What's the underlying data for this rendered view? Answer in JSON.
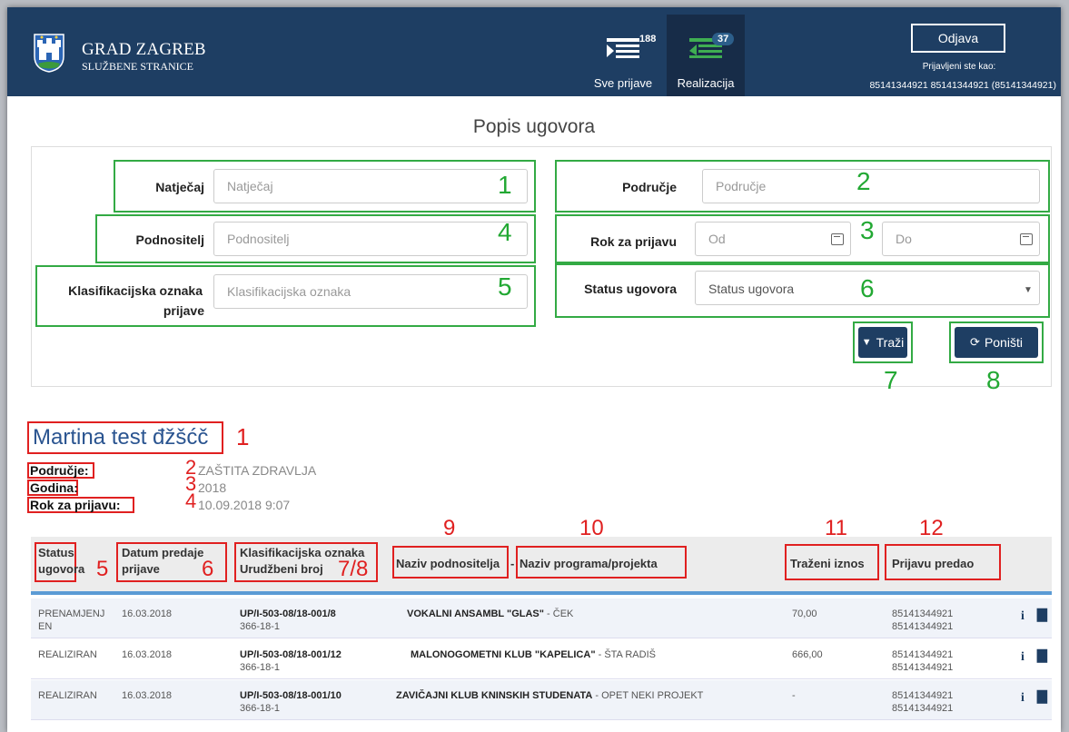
{
  "header": {
    "brand_title": "GRAD ZAGREB",
    "brand_subtitle": "SLUŽBENE STRANICE",
    "nav": [
      {
        "label": "Sve prijave",
        "badge": "188"
      },
      {
        "label": "Realizacija",
        "badge": "37"
      }
    ],
    "logout_label": "Odjava",
    "logged_in_label": "Prijavljeni ste kao:",
    "logged_in_user": "85141344921 85141344921 (85141344921)"
  },
  "page_title": "Popis ugovora",
  "filters": {
    "natjecaj": {
      "label": "Natječaj",
      "placeholder": "Natječaj",
      "num": "1"
    },
    "podrucje": {
      "label": "Područje",
      "placeholder": "Područje",
      "num": "2"
    },
    "rok": {
      "label": "Rok za prijavu",
      "from_placeholder": "Od",
      "to_placeholder": "Do",
      "num": "3"
    },
    "podnositelj": {
      "label": "Podnositelj",
      "placeholder": "Podnositelj",
      "num": "4"
    },
    "klasifikacija": {
      "label_line1": "Klasifikacijska oznaka",
      "label_line2": "prijave",
      "placeholder": "Klasifikacijska oznaka",
      "num": "5"
    },
    "status": {
      "label": "Status ugovora",
      "selected": "Status ugovora",
      "num": "6"
    },
    "search_button": "Traži",
    "reset_button": "Poništi",
    "search_num": "7",
    "reset_num": "8"
  },
  "contest": {
    "name": "Martina test đžšćč",
    "name_num": "1",
    "rows": [
      {
        "label": "Područje:",
        "value": "ZAŠTITA ZDRAVLJA",
        "num": "2"
      },
      {
        "label": "Godina:",
        "value": "2018",
        "num": "3"
      },
      {
        "label": "Rok za prijavu:",
        "value": "10.09.2018 9:07",
        "num": "4"
      }
    ]
  },
  "table": {
    "headers": {
      "status_l1": "Status",
      "status_l2": "ugovora",
      "status_num": "5",
      "datum_l1": "Datum predaje",
      "datum_l2": "prijave",
      "datum_num": "6",
      "klas_l1": "Klasifikacijska oznaka",
      "klas_l2": "Urudžbeni broj",
      "klas_num": "7/8",
      "naziv_podnositelja": "Naziv podnositelja",
      "sep": "-",
      "naziv_podnositelja_num": "9",
      "naziv_programa": "Naziv programa/projekta",
      "naziv_programa_num": "10",
      "trazeni": "Traženi iznos",
      "trazeni_num": "11",
      "predao": "Prijavu predao",
      "predao_num": "12"
    },
    "rows": [
      {
        "status_l1": "PRENAMJENJ",
        "status_l2": "EN",
        "datum": "16.03.2018",
        "klas": "UP/I-503-08/18-001/8",
        "urud": "366-18-1",
        "podnositelj": "VOKALNI ANSAMBL \"GLAS\"",
        "projekt": " - ČEK",
        "iznos": "70,00",
        "predao_l1": "85141344921",
        "predao_l2": "85141344921"
      },
      {
        "status_l1": "REALIZIRAN",
        "status_l2": "",
        "datum": "16.03.2018",
        "klas": "UP/I-503-08/18-001/12",
        "urud": "366-18-1",
        "podnositelj": "MALONOGOMETNI KLUB \"KAPELICA\"",
        "projekt": " - ŠTA RADIŠ",
        "iznos": "666,00",
        "predao_l1": "85141344921",
        "predao_l2": "85141344921"
      },
      {
        "status_l1": "REALIZIRAN",
        "status_l2": "",
        "datum": "16.03.2018",
        "klas": "UP/I-503-08/18-001/10",
        "urud": "366-18-1",
        "podnositelj": "ZAVIČAJNI KLUB KNINSKIH STUDENATA",
        "projekt": " - OPET NEKI PROJEKT",
        "iznos": "-",
        "predao_l1": "85141344921",
        "predao_l2": "85141344921"
      }
    ]
  },
  "colors": {
    "header_bg": "#1e3e63",
    "green_annotation": "#33aa44",
    "red_annotation": "#e02020",
    "link_blue": "#2a5490"
  }
}
